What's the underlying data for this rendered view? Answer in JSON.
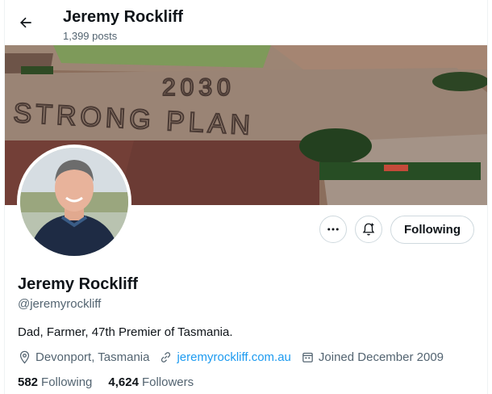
{
  "header": {
    "name": "Jeremy Rockliff",
    "posts": "1,399 posts"
  },
  "banner": {
    "line1": "2030",
    "line2": "STRONG PLAN"
  },
  "actions": {
    "follow_label": "Following"
  },
  "profile": {
    "name": "Jeremy Rockliff",
    "handle": "@jeremyrockliff",
    "bio": "Dad, Farmer, 47th Premier of Tasmania.",
    "location": "Devonport, Tasmania",
    "website": "jeremyrockliff.com.au",
    "joined": "Joined December 2009"
  },
  "stats": {
    "following_count": "582",
    "following_label": "Following",
    "followers_count": "4,624",
    "followers_label": "Followers"
  },
  "colors": {
    "accent": "#1d9bf0",
    "muted": "#536471",
    "text": "#0f1419"
  }
}
